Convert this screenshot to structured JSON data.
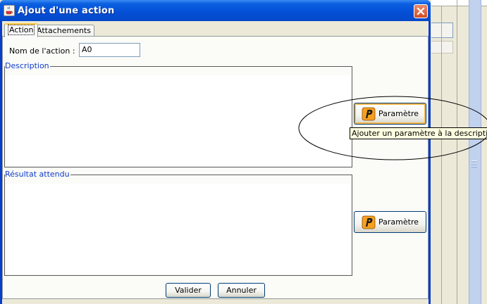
{
  "dialog": {
    "title": "Ajout d'une action",
    "tabs": [
      {
        "label": "Action",
        "active": true
      },
      {
        "label": "Attachements",
        "active": false
      }
    ],
    "name_field": {
      "label": "Nom de l'action :",
      "value": "A0"
    },
    "description": {
      "title": "Description",
      "value": ""
    },
    "expected_result": {
      "title": "Résultat attendu",
      "value": ""
    },
    "param_button_1": {
      "label": "Paramètre",
      "tooltip": "Ajouter un paramètre à la description"
    },
    "param_button_2": {
      "label": "Paramètre"
    },
    "ok_label": "Valider",
    "cancel_label": "Annuler"
  },
  "icons": {
    "title": "java-cup-icon",
    "close": "close-icon",
    "param": "p-letter-icon"
  },
  "colors": {
    "titlebar": "#0550d8",
    "group_title": "#0f3dc9",
    "close_button": "#d34c26",
    "tooltip_bg": "#ffffe1",
    "param_icon_fill": "#f5a01e"
  }
}
